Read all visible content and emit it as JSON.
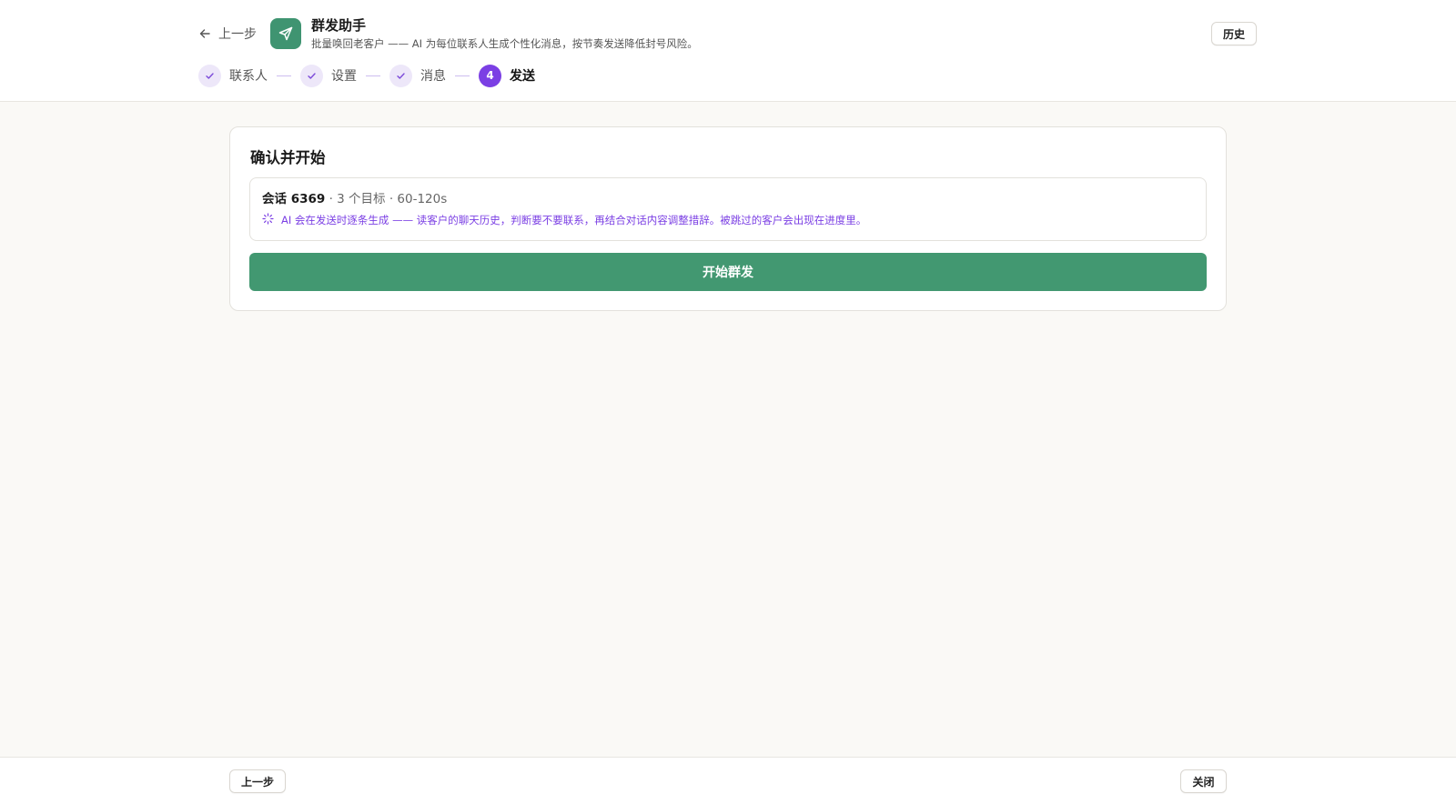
{
  "header": {
    "back_label": "上一步",
    "app_icon": "send-icon",
    "title": "群发助手",
    "subtitle": "批量唤回老客户 —— AI 为每位联系人生成个性化消息，按节奏发送降低封号风险。",
    "history_label": "历史"
  },
  "steps": [
    {
      "label": "联系人",
      "status": "done",
      "icon": "check-icon"
    },
    {
      "label": "设置",
      "status": "done",
      "icon": "check-icon"
    },
    {
      "label": "消息",
      "status": "done",
      "icon": "check-icon"
    },
    {
      "label": "发送",
      "status": "active",
      "number": "4"
    }
  ],
  "confirm": {
    "title": "确认并开始",
    "session_label": "会话 6369",
    "meta": " · 3 个目标 · 60-120s",
    "ai_note": "AI 会在发送时逐条生成 —— 读客户的聊天历史，判断要不要联系，再结合对话内容调整措辞。被跳过的客户会出现在进度里。",
    "start_label": "开始群发"
  },
  "footer": {
    "prev_label": "上一步",
    "close_label": "关闭"
  },
  "colors": {
    "brand_green": "#429871",
    "accent_purple": "#7b3fe4",
    "background": "#faf9f6"
  }
}
